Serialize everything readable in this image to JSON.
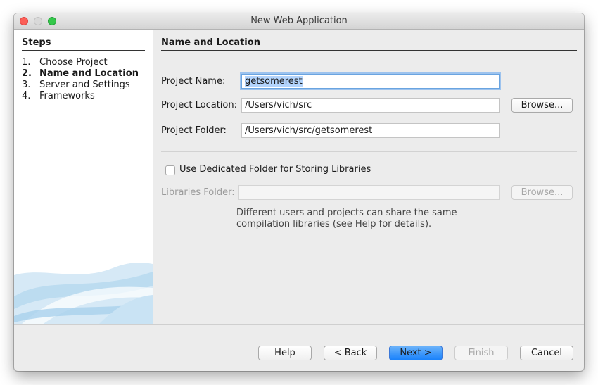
{
  "window": {
    "title": "New Web Application"
  },
  "steps": {
    "title": "Steps",
    "items": [
      {
        "num": "1.",
        "label": "Choose Project"
      },
      {
        "num": "2.",
        "label": "Name and Location"
      },
      {
        "num": "3.",
        "label": "Server and Settings"
      },
      {
        "num": "4.",
        "label": "Frameworks"
      }
    ]
  },
  "main": {
    "section_title": "Name and Location",
    "project_name": {
      "label": "Project Name:",
      "value": "getsomerest"
    },
    "project_location": {
      "label": "Project Location:",
      "value": "/Users/vich/src",
      "browse_label": "Browse..."
    },
    "project_folder": {
      "label": "Project Folder:",
      "value": "/Users/vich/src/getsomerest"
    },
    "dedicated_folder": {
      "label": "Use Dedicated Folder for Storing Libraries",
      "checked": false
    },
    "libraries_folder": {
      "label": "Libraries Folder:",
      "value": "",
      "browse_label": "Browse..."
    },
    "note_line1": "Different users and projects can share the same",
    "note_line2": "compilation libraries (see Help for details)."
  },
  "buttons": {
    "help": "Help",
    "back": "< Back",
    "next": "Next >",
    "finish": "Finish",
    "cancel": "Cancel"
  }
}
